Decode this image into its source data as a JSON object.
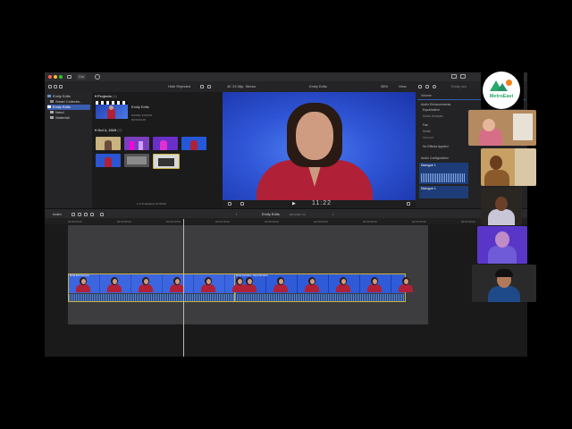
{
  "app": {
    "toolbar": {
      "left_button": "Gra",
      "hide_rejected": "Hide Rejected",
      "format": "4K 23.98p, Stereo",
      "viewer_title": "Emily Edits",
      "zoom": "98%",
      "view": "View",
      "right_label": "Emily ses"
    },
    "sidebar": {
      "items": [
        {
          "label": "Emily Edits",
          "icon": "library-icon"
        },
        {
          "label": "Smart Collectio...",
          "icon": "folder-icon"
        },
        {
          "label": "Emily Edits",
          "icon": "event-icon",
          "selected": true
        },
        {
          "label": "Need",
          "icon": "event-icon"
        },
        {
          "label": "Waterfall",
          "icon": "event-icon"
        }
      ]
    },
    "browser": {
      "projects_header": "Projects",
      "projects_count": "(1)",
      "project_name": "Emily Edits",
      "project_date": "5/24/20, 9:06 PM",
      "project_duration": "00:00:54:18",
      "date_group": "Oct 2, 2019",
      "date_count": "(7)",
      "selection_status": "1 of 8 selected, 01:00:00"
    },
    "viewer": {
      "timecode": "11:22"
    },
    "inspector": {
      "volume": "Volume",
      "audio_enhancements": "Audio Enhancements",
      "equalization": "Equalization",
      "audio_analysis": "Audio Analysis",
      "pan": "Pan",
      "mode": "Mode",
      "amount": "Amount",
      "effects_applied": "No Effects Applied",
      "audio_configuration": "Audio Configuration",
      "dialogue_1": "Dialogue 1",
      "dialogue_2": "Dialogue 1"
    },
    "timeline": {
      "index": "Index",
      "project": "Emily Edits",
      "duration": "00:14:08 / 14",
      "ruler_ticks": [
        "00:00:00:00",
        "00:00:05:00",
        "00:00:10:00",
        "00:00:15:00",
        "00:00:20:00",
        "00:00:25:00",
        "00:00:30:00",
        "00:00:35:00",
        "00:00:40:00"
      ],
      "clip1_name": "Emily Edit Interview",
      "clip2_name": "Emily Interview - Seg Trail wider"
    }
  },
  "logo": {
    "text": "MetroEast"
  },
  "colors": {
    "accent": "#3a5dad",
    "clip_border": "#c9b23e",
    "viewer_bg": "#2f55d6",
    "shirt": "#b02037",
    "logo_green": "#2aa86c",
    "logo_orange": "#f2841f"
  }
}
